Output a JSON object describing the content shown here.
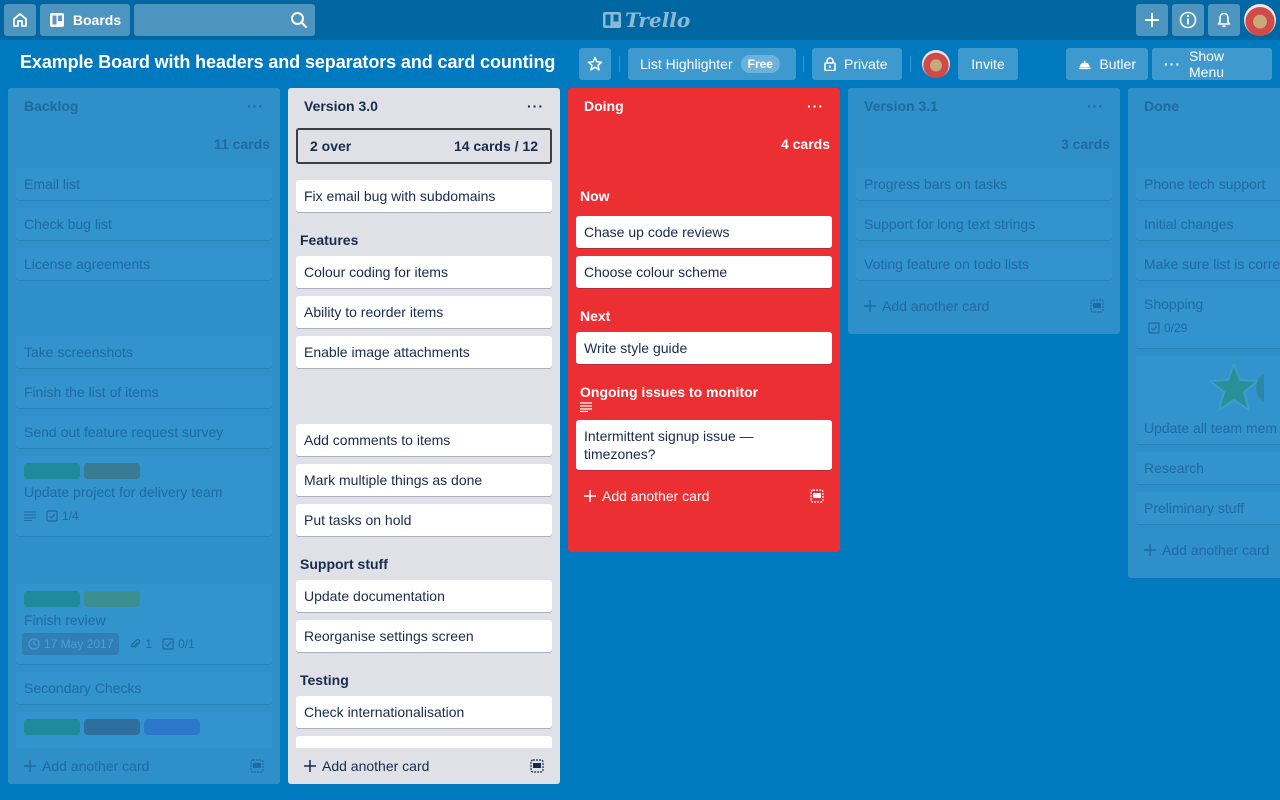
{
  "nav": {
    "boards_label": "Boards",
    "search_placeholder": "",
    "logo_text": "Trello"
  },
  "board": {
    "title": "Example Board with headers and separators and card counting",
    "power_up_label": "List Highlighter",
    "power_up_badge": "Free",
    "visibility_label": "Private",
    "invite_label": "Invite",
    "butler_label": "Butler",
    "show_menu_label": "Show Menu"
  },
  "colors": {
    "board_bg": "#0079bf",
    "highlight_list": "#eb2f33",
    "label_teal": "#1e8a9a",
    "label_slate": "#2f6fa0",
    "label_blue": "#2e78cc",
    "label_green": "#3a9090"
  },
  "add_card_label": "Add another card",
  "lists": [
    {
      "title": "Backlog",
      "count": "11 cards",
      "cards": [
        {
          "title": "Email list"
        },
        {
          "title": "Check bug list"
        },
        {
          "title": "License agreements"
        },
        {
          "title": "Take screenshots"
        },
        {
          "title": "Finish the list of items"
        },
        {
          "title": "Send out feature request survey"
        },
        {
          "title": "Update project for delivery team",
          "checklist": "1/4"
        },
        {
          "title": "Finish review",
          "due": "17 May 2017",
          "attachments": "1",
          "checklist": "0/1"
        },
        {
          "title": "Secondary Checks"
        }
      ]
    },
    {
      "title": "Version 3.0",
      "over": "2 over",
      "count": "14 cards / 12",
      "cards": [
        {
          "title": "Fix email bug with subdomains"
        },
        {
          "title": "Colour coding for items"
        },
        {
          "title": "Ability to reorder items"
        },
        {
          "title": "Enable image attachments"
        },
        {
          "title": "Add comments to items"
        },
        {
          "title": "Mark multiple things as done"
        },
        {
          "title": "Put tasks on hold"
        },
        {
          "title": "Update documentation"
        },
        {
          "title": "Reorganise settings screen"
        },
        {
          "title": "Check internationalisation"
        }
      ],
      "sections": [
        "Features",
        "Support stuff",
        "Testing"
      ]
    },
    {
      "title": "Doing",
      "count": "4 cards",
      "sections": [
        "Now",
        "Next",
        "Ongoing issues to monitor"
      ],
      "cards": [
        {
          "title": "Chase up code reviews"
        },
        {
          "title": "Choose colour scheme"
        },
        {
          "title": "Write style guide"
        },
        {
          "title": "Intermittent signup issue — timezones?"
        }
      ]
    },
    {
      "title": "Version 3.1",
      "count": "3 cards",
      "cards": [
        {
          "title": "Progress bars on tasks"
        },
        {
          "title": "Support for long text strings"
        },
        {
          "title": "Voting feature on todo lists"
        }
      ]
    },
    {
      "title": "Done",
      "cards": [
        {
          "title": "Phone tech support"
        },
        {
          "title": "Initial changes"
        },
        {
          "title": "Make sure list is corre"
        },
        {
          "title": "Shopping",
          "checklist": "0/29"
        },
        {
          "title": "Update all team mem"
        },
        {
          "title": "Research"
        },
        {
          "title": "Preliminary stuff"
        }
      ]
    }
  ]
}
